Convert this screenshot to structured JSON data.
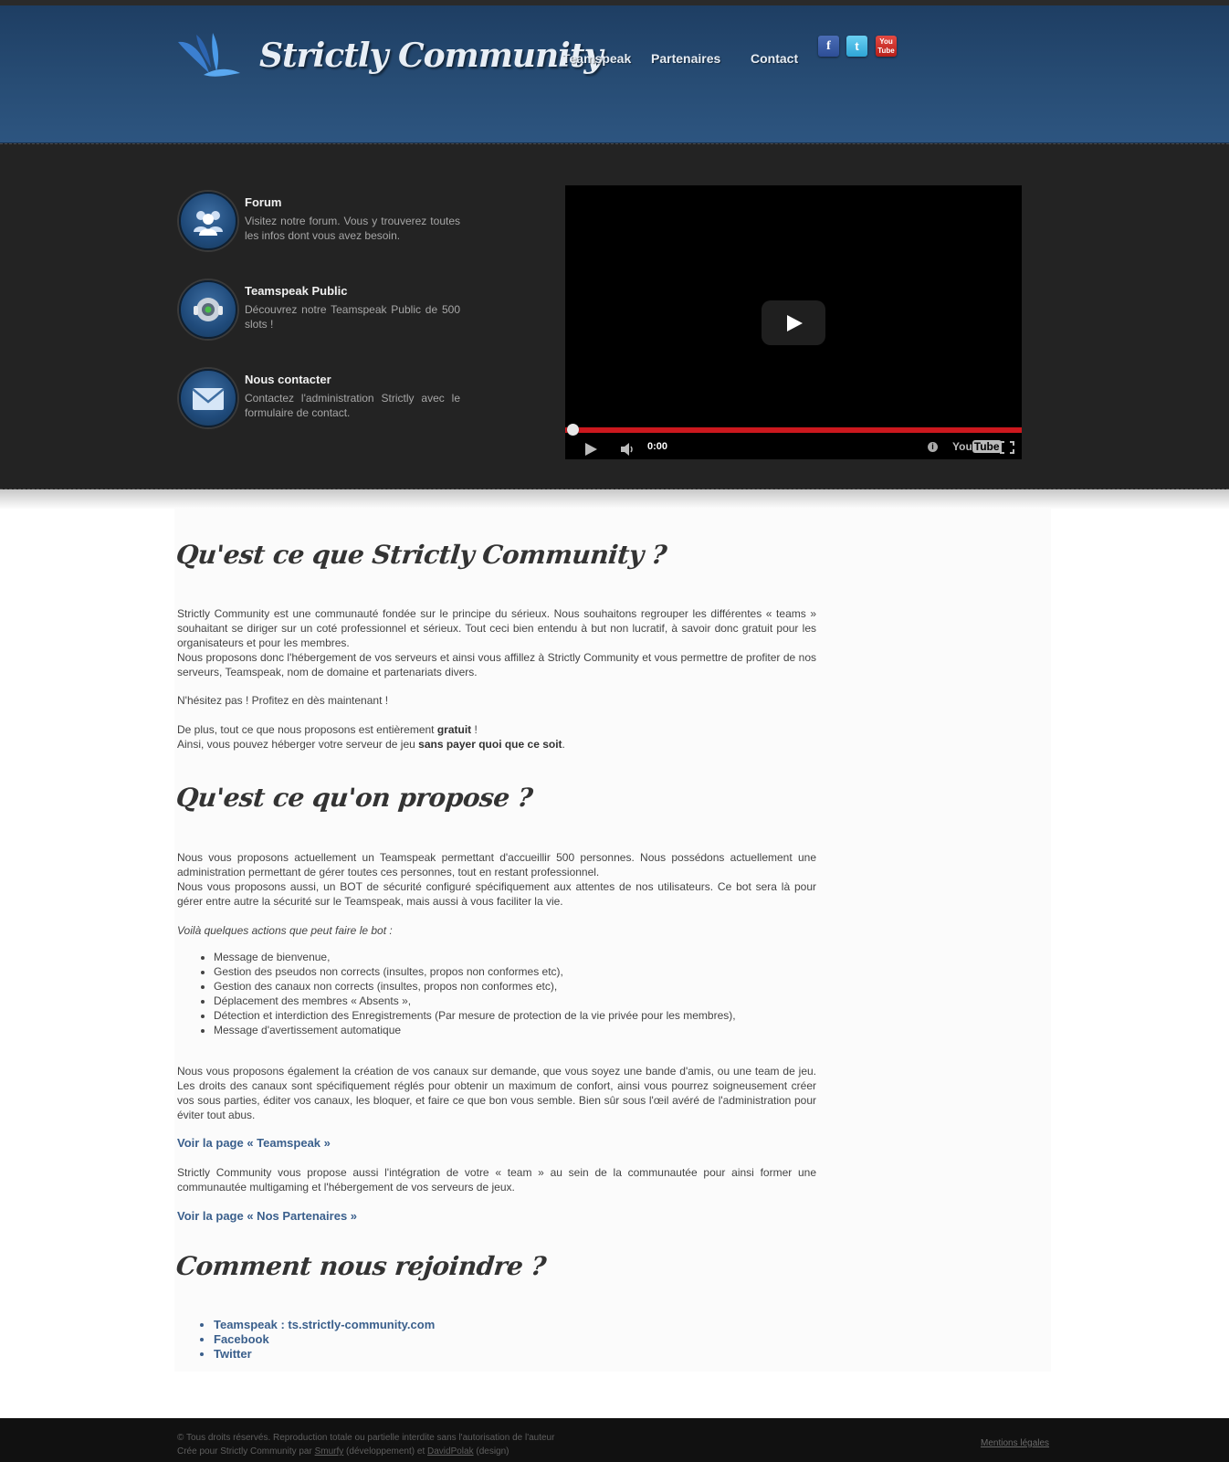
{
  "header": {
    "logo_text": "Strictly Community",
    "nav": [
      "Teamspeak",
      "Partenaires",
      "Contact"
    ],
    "social": {
      "facebook": "f",
      "twitter": "t",
      "youtube_top": "You",
      "youtube_bottom": "Tube"
    }
  },
  "features": [
    {
      "icon": "users-icon",
      "title": "Forum",
      "desc": "Visitez notre forum. Vous y trouverez toutes les infos dont vous avez besoin."
    },
    {
      "icon": "headset-icon",
      "title": "Teamspeak Public",
      "desc": "Découvrez notre Teamspeak Public de 500 slots !"
    },
    {
      "icon": "envelope-icon",
      "title": "Nous contacter",
      "desc": "Contactez l'administration Strictly avec le formulaire de contact."
    }
  ],
  "video": {
    "time": "0:00",
    "progress": 0.0,
    "info": "i",
    "yt_you": "You",
    "yt_tube": "Tube"
  },
  "sections": {
    "s1_title": "Qu'est ce que Strictly Community ?",
    "s1_p1": "Strictly Community est une communauté fondée sur le principe du sérieux. Nous souhaitons regrouper les différentes « teams » souhaitant se diriger sur un coté professionnel et sérieux. Tout ceci bien entendu à but non lucratif, à savoir donc gratuit pour les organisateurs et pour les membres.",
    "s1_p2": "Nous proposons donc l'hébergement de vos serveurs et ainsi vous affillez à Strictly Community et vous permettre de profiter de nos serveurs, Teamspeak, nom de domaine et partenariats divers.",
    "s1_p3": "N'hésitez pas ! Profitez en dès maintenant !",
    "s1_p4a": "De plus, tout ce que nous proposons est entièrement ",
    "s1_p4b": "gratuit",
    "s1_p4c": " !",
    "s1_p5a": "Ainsi, vous pouvez héberger votre serveur de jeu ",
    "s1_p5b": "sans payer quoi que ce soit",
    "s1_p5c": ".",
    "s2_title": "Qu'est ce qu'on propose ?",
    "s2_p1": "Nous vous proposons actuellement un Teamspeak permettant d'accueillir 500 personnes. Nous possédons actuellement une administration permettant de gérer toutes ces personnes, tout en restant professionnel.",
    "s2_p2": "Nous vous proposons aussi, un BOT de sécurité configuré spécifiquement aux attentes de nos utilisateurs. Ce bot sera là pour gérer entre autre la sécurité sur le Teamspeak, mais aussi à vous faciliter la vie.",
    "s2_intro": "Voilà quelques actions que peut faire le bot :",
    "s2_list": [
      "Message de bienvenue,",
      "Gestion des pseudos non corrects (insultes, propos non conformes etc),",
      "Gestion des canaux non corrects (insultes, propos non conformes etc),",
      "Déplacement des membres « Absents »,",
      "Détection et interdiction des Enregistrements (Par mesure de protection de la vie privée pour les membres),",
      "Message d'avertissement automatique"
    ],
    "s2_p3": "Nous vous proposons également la création de vos canaux sur demande, que vous soyez une bande d'amis, ou une team de jeu. Les droits des canaux sont spécifiquement réglés pour obtenir un maximum de confort, ainsi vous pourrez soigneusement créer vos sous parties, éditer vos canaux, les bloquer, et faire ce que bon vous semble. Bien sûr sous l'œil avéré de l'administration pour éviter tout abus.",
    "s2_link1": "Voir la page « Teamspeak »",
    "s2_p4": "Strictly Community vous propose aussi l'intégration de votre « team » au sein de la communautée pour ainsi former une communautée multigaming et l'hébergement de vos serveurs de jeux.",
    "s2_link2": "Voir la page « Nos Partenaires »",
    "s3_title": "Comment nous rejoindre ?",
    "s3_links": [
      "Teamspeak : ts.strictly-community.com",
      "Facebook",
      "Twitter"
    ]
  },
  "footer": {
    "line1": "© Tous droits réservés. Reproduction totale ou partielle interdite sans l'autorisation de l'auteur",
    "line2a": "Crée pour Strictly Community par ",
    "line2b": "Smurfy",
    "line2c": " (développement) et ",
    "line2d": "DavidPolak",
    "line2e": " (design)",
    "legal": "Mentions légales"
  }
}
